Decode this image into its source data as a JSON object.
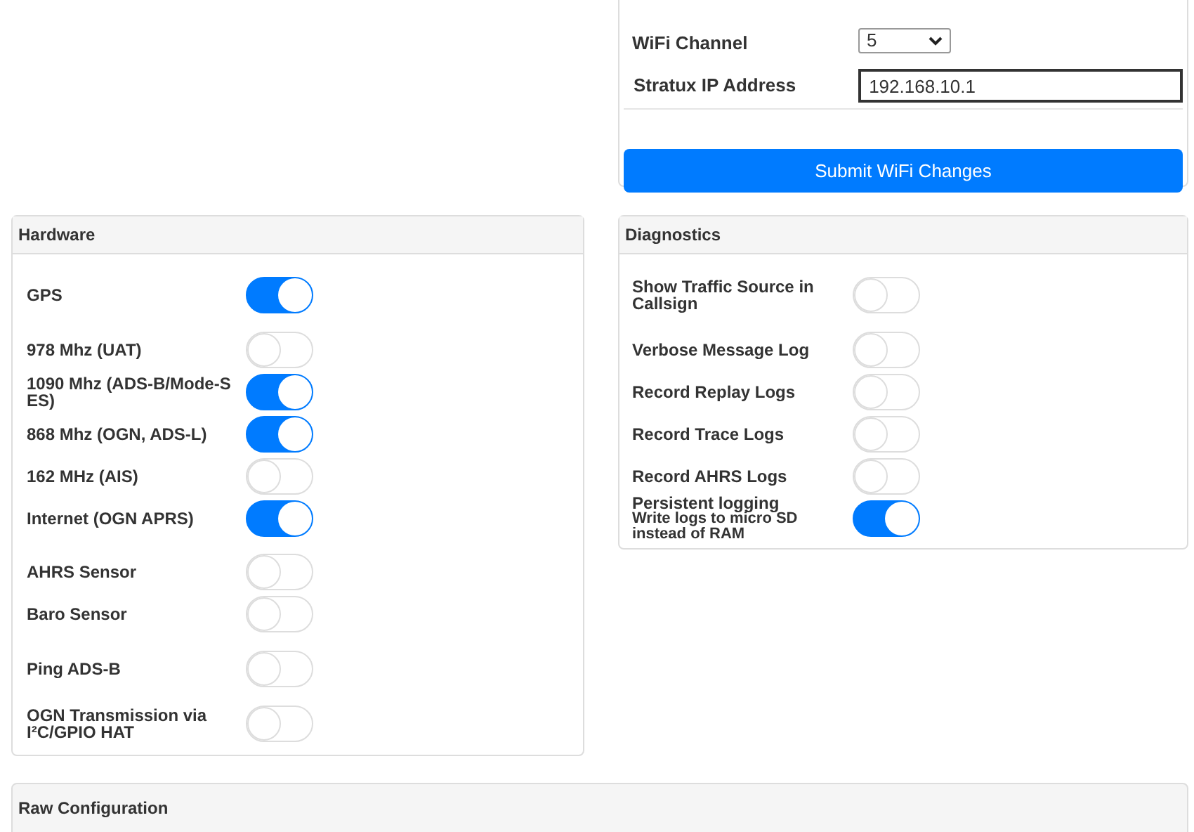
{
  "wifi": {
    "channel_label": "WiFi Channel",
    "channel_value": "5",
    "ip_label": "Stratux IP Address",
    "ip_value": "192.168.10.1",
    "submit": "Submit WiFi Changes"
  },
  "hardware": {
    "title": "Hardware",
    "items": [
      {
        "label": "GPS",
        "on": true
      },
      {
        "label": "978 Mhz (UAT)",
        "on": false
      },
      {
        "label": "1090 Mhz (ADS-B/Mode-S ES)",
        "on": true
      },
      {
        "label": "868 Mhz (OGN, ADS-L)",
        "on": true
      },
      {
        "label": "162 MHz (AIS)",
        "on": false
      },
      {
        "label": "Internet (OGN APRS)",
        "on": true
      },
      {
        "label": "AHRS Sensor",
        "on": false
      },
      {
        "label": "Baro Sensor",
        "on": false
      },
      {
        "label": "Ping ADS-B",
        "on": false
      },
      {
        "label": "OGN Transmission via I²C/GPIO HAT",
        "on": false
      }
    ]
  },
  "diagnostics": {
    "title": "Diagnostics",
    "items": [
      {
        "label": "Show Traffic Source in Callsign",
        "on": false
      },
      {
        "label": "Verbose Message Log",
        "on": false
      },
      {
        "label": "Record Replay Logs",
        "on": false
      },
      {
        "label": "Record Trace Logs",
        "on": false
      },
      {
        "label": "Record AHRS Logs",
        "on": false
      },
      {
        "label": "Persistent logging",
        "hint": "Write logs to micro SD instead of RAM",
        "on": true
      }
    ]
  },
  "raw": {
    "title": "Raw Configuration"
  }
}
